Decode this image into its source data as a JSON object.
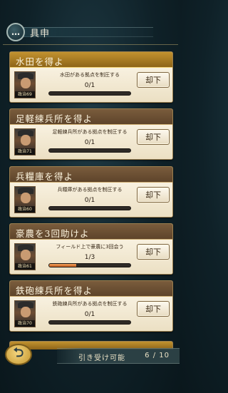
{
  "header": {
    "icon": "speech-bubble-icon",
    "title": "具申"
  },
  "missions": [
    {
      "title": "水田を得よ",
      "description": "水田がある拠点を制圧する",
      "progress_text": "0/1",
      "progress_fraction": 0,
      "stat_label": "政治69",
      "button_label": "却下",
      "highlighted": true
    },
    {
      "title": "足軽練兵所を得よ",
      "description": "足軽練兵所がある拠点を制圧する",
      "progress_text": "0/1",
      "progress_fraction": 0,
      "stat_label": "政治71",
      "button_label": "却下",
      "highlighted": false
    },
    {
      "title": "兵糧庫を得よ",
      "description": "兵糧庫がある拠点を制圧する",
      "progress_text": "0/1",
      "progress_fraction": 0,
      "stat_label": "政治60",
      "button_label": "却下",
      "highlighted": false
    },
    {
      "title": "豪農を3回助けよ",
      "description": "フィールド上で豪農に3回会う",
      "progress_text": "1/3",
      "progress_fraction": 0.333,
      "stat_label": "政治61",
      "button_label": "却下",
      "highlighted": false
    },
    {
      "title": "鉄砲練兵所を得よ",
      "description": "鉄砲練兵所がある拠点を制圧する",
      "progress_text": "0/1",
      "progress_fraction": 0,
      "stat_label": "政治70",
      "button_label": "却下",
      "highlighted": false
    }
  ],
  "footer": {
    "back_icon": "back-arrow-icon",
    "accept_label": "引き受け可能",
    "accept_value": "6 / 10"
  }
}
